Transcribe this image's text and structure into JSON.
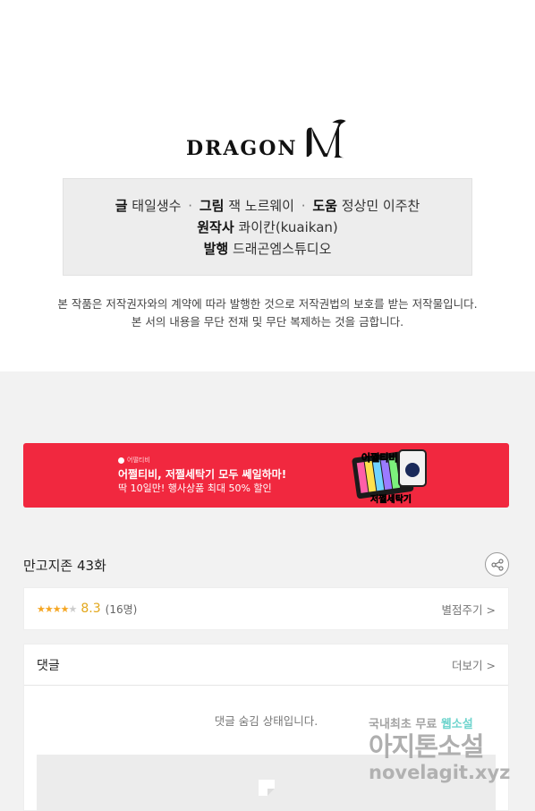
{
  "logo": {
    "text": "DRAGON",
    "letter": "M"
  },
  "credits": {
    "line1": [
      {
        "label": "글",
        "value": "태일생수"
      },
      {
        "label": "그림",
        "value": "잭 노르웨이"
      },
      {
        "label": "도움",
        "value": "정상민 이주찬"
      }
    ],
    "line2": {
      "label": "원작사",
      "value": "콰이칸(kuaikan)"
    },
    "line3": {
      "label": "발행",
      "value": "드래곤엠스튜디오"
    },
    "separator": "·"
  },
  "notice": {
    "line1": "본 작품은 저작권자와의 계약에 따라 발행한 것으로 저작권법의 보호를 받는 저작물입니다.",
    "line2": "본 서의 내용을 무단 전재 및 무단 복제하는 것을 금합니다."
  },
  "banner": {
    "brand": "어떨티비",
    "title": "어쩔티비, 저쩔세탁기 모두 쎄일하마!",
    "subtitle": "딱 10일만! 행사상품 최대 50% 할인",
    "art_top": "어쩔티비",
    "art_bottom": "저쩔세탁기",
    "color": "#f1283f"
  },
  "episode": {
    "title": "만고지존 43화",
    "share_icon": "share-icon"
  },
  "rating": {
    "stars_filled": 4,
    "stars_total": 5,
    "score": "8.3",
    "count": "(16명)",
    "rate_label": "별점주기 >"
  },
  "comments": {
    "title": "댓글",
    "more_label": "더보기 >",
    "hidden_message": "댓글 숨김 상태입니다."
  },
  "watermark": {
    "line1_a": "국내최초 무료 ",
    "line1_b": "웹소설",
    "line2": "아지톤소설",
    "line3": "novelagit.xyz"
  }
}
